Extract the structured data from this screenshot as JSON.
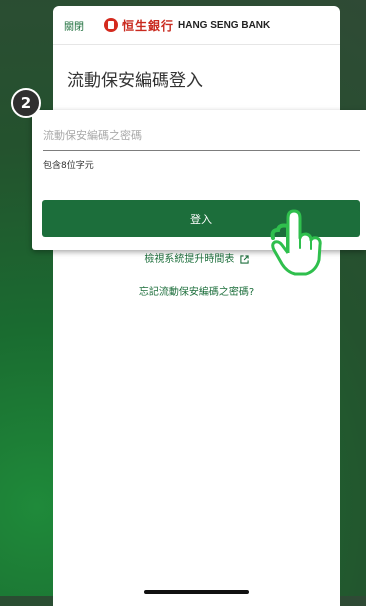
{
  "header": {
    "close_label": "關閉",
    "bank_name_cn": "恒生銀行",
    "bank_name_en": "HANG SENG BANK"
  },
  "page_title": "流動保安編碼登入",
  "form": {
    "password_placeholder": "流動保安編碼之密碼",
    "password_hint": "包含8位字元",
    "login_label": "登入"
  },
  "links": {
    "maintenance_label": "檢視系統提升時間表",
    "forgot_label": "忘記流動保安編碼之密碼?"
  },
  "step_badge": "2",
  "colors": {
    "brand_green": "#1c6e3b",
    "logo_red": "#d42a1e"
  },
  "icons": [
    "external-link-icon",
    "pointing-hand-icon",
    "hang-seng-logo-icon"
  ]
}
